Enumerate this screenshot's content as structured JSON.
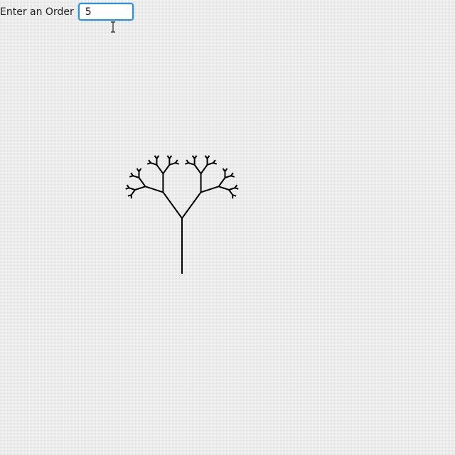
{
  "form": {
    "order_label": "Enter an Order",
    "order_value": "5"
  },
  "tree": {
    "order": 5,
    "branch_color": "#000000"
  },
  "colors": {
    "input_border": "#2e93d4",
    "background": "#f4f4f4"
  }
}
